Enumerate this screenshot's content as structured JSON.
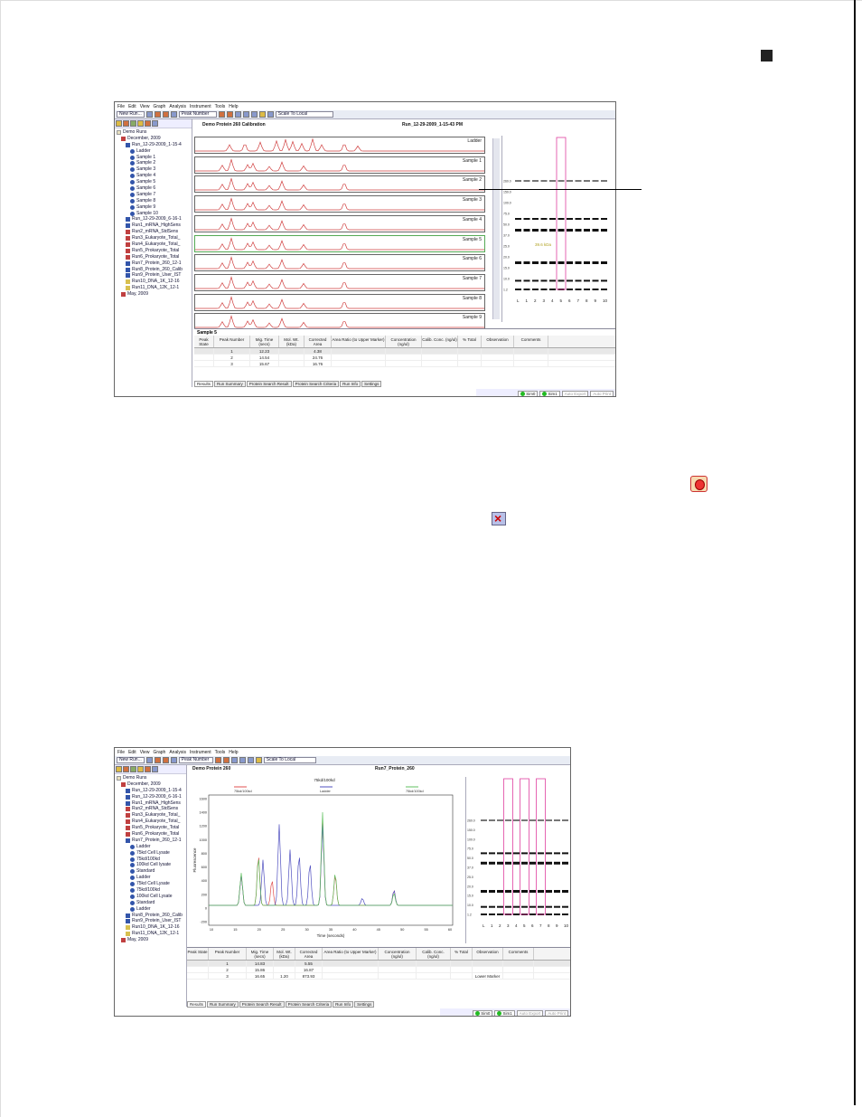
{
  "page": {
    "marker": "black-square",
    "callout": "callout-line"
  },
  "window1": {
    "menu": [
      "File",
      "Edit",
      "View",
      "Graph",
      "Analysis",
      "Instrument",
      "Tools",
      "Help"
    ],
    "toolbar": {
      "new_run": "New Run...",
      "peak_mode": "Peak Number",
      "scale_mode": "Scale To Local"
    },
    "tree": [
      {
        "label": "Demo Runs",
        "icon": "folder",
        "indent": 0
      },
      {
        "label": "December, 2009",
        "icon": "calendar",
        "indent": 1
      },
      {
        "label": "Run_12-29-2009_1-15-4",
        "icon": "run",
        "indent": 2
      },
      {
        "label": "Ladder",
        "icon": "circle",
        "indent": 3
      },
      {
        "label": "Sample 1",
        "icon": "circle",
        "indent": 3
      },
      {
        "label": "Sample 2",
        "icon": "circle",
        "indent": 3
      },
      {
        "label": "Sample 3",
        "icon": "circle",
        "indent": 3
      },
      {
        "label": "Sample 4",
        "icon": "circle",
        "indent": 3
      },
      {
        "label": "Sample 5",
        "icon": "circle",
        "indent": 3
      },
      {
        "label": "Sample 6",
        "icon": "circle",
        "indent": 3
      },
      {
        "label": "Sample 7",
        "icon": "circle",
        "indent": 3
      },
      {
        "label": "Sample 8",
        "icon": "circle",
        "indent": 3
      },
      {
        "label": "Sample 9",
        "icon": "circle",
        "indent": 3
      },
      {
        "label": "Sample 10",
        "icon": "circle",
        "indent": 3
      },
      {
        "label": "Run_12-29-2009_6-16-1",
        "icon": "run",
        "indent": 2
      },
      {
        "label": "Run1_mRNA_HighSens",
        "icon": "run",
        "indent": 2
      },
      {
        "label": "Run2_mRNA_StdSens",
        "icon": "run-red",
        "indent": 2
      },
      {
        "label": "Run3_Eukaryote_Total_",
        "icon": "run-red",
        "indent": 2
      },
      {
        "label": "Run4_Eukaryote_Total_",
        "icon": "run-red",
        "indent": 2
      },
      {
        "label": "Run5_Prokaryote_Total",
        "icon": "run-red",
        "indent": 2
      },
      {
        "label": "Run6_Prokaryote_Total",
        "icon": "run-red",
        "indent": 2
      },
      {
        "label": "Run7_Protein_260_12-1",
        "icon": "run",
        "indent": 2
      },
      {
        "label": "Run8_Protein_260_Calib",
        "icon": "run",
        "indent": 2
      },
      {
        "label": "Run9_Protein_User_IST",
        "icon": "run",
        "indent": 2
      },
      {
        "label": "Run10_DNA_1K_12-16",
        "icon": "run-yellow",
        "indent": 2
      },
      {
        "label": "Run11_DNA_12K_12-1",
        "icon": "run-yellow",
        "indent": 2
      },
      {
        "label": "May, 2009",
        "icon": "calendar",
        "indent": 1
      }
    ],
    "header_left": "Demo Protein 260 Calibration",
    "header_right": "Run_12-29-2009_1-15-43 PM",
    "traces": [
      "Ladder",
      "Sample 1",
      "Sample 2",
      "Sample 3",
      "Sample 4",
      "Sample 5",
      "Sample 6",
      "Sample 7",
      "Sample 8",
      "Sample 9"
    ],
    "gel": {
      "markers": [
        "260.0",
        "150.0",
        "100.0",
        "75.0",
        "50.0",
        "37.0",
        "25.0",
        "20.0",
        "15.0",
        "10.0",
        "1.2"
      ],
      "lanes": [
        "L",
        "1",
        "2",
        "3",
        "4",
        "5",
        "6",
        "7",
        "8",
        "9",
        "10"
      ],
      "annotation": "39.6 kDa"
    },
    "table": {
      "title": "Sample 5",
      "headers": [
        "Peak State",
        "Peak Number",
        "Mig. Time (secs)",
        "Mol. Wt. (kDa)",
        "Corrected Area",
        "Area Ratio (to Upper Marker)",
        "Concentration (ng/ul)",
        "Calib. Conc. (ng/ul)",
        "% Total",
        "Observation",
        "Comments"
      ],
      "rows": [
        [
          "",
          "1",
          "12.23",
          "",
          "4.38",
          "",
          "",
          "",
          "",
          "",
          ""
        ],
        [
          "",
          "2",
          "14.54",
          "",
          "24.76",
          "",
          "",
          "",
          "",
          "",
          ""
        ],
        [
          "",
          "3",
          "15.67",
          "",
          "16.76",
          "",
          "",
          "",
          "",
          "",
          ""
        ]
      ]
    },
    "tabs": [
      "Results",
      "Run Summary",
      "Protein Search Result",
      "Protein Search Criteria",
      "Run Info",
      "Settings"
    ],
    "status": {
      "sim0": "Sim0",
      "sim1": "Sim1",
      "auto_export": "Auto Export",
      "auto_print": "Auto Print"
    }
  },
  "window2": {
    "menu": [
      "File",
      "Edit",
      "View",
      "Graph",
      "Analysis",
      "Instrument",
      "Tools",
      "Help"
    ],
    "toolbar": {
      "new_run": "New Run...",
      "peak_mode": "Peak Number",
      "scale_mode": "Scale To Local"
    },
    "tree": [
      {
        "label": "Demo Runs",
        "icon": "folder",
        "indent": 0
      },
      {
        "label": "December, 2009",
        "icon": "calendar",
        "indent": 1
      },
      {
        "label": "Run_12-29-2009_1-15-4",
        "icon": "run",
        "indent": 2
      },
      {
        "label": "Run_12-29-2009_6-16-1",
        "icon": "run",
        "indent": 2
      },
      {
        "label": "Run1_mRNA_HighSens",
        "icon": "run",
        "indent": 2
      },
      {
        "label": "Run2_mRNA_StdSens",
        "icon": "run-red",
        "indent": 2
      },
      {
        "label": "Run3_Eukaryote_Total_",
        "icon": "run-red",
        "indent": 2
      },
      {
        "label": "Run4_Eukaryote_Total_",
        "icon": "run-red",
        "indent": 2
      },
      {
        "label": "Run5_Prokaryote_Total",
        "icon": "run-red",
        "indent": 2
      },
      {
        "label": "Run6_Prokaryote_Total",
        "icon": "run-red",
        "indent": 2
      },
      {
        "label": "Run7_Protein_260_12-1",
        "icon": "run",
        "indent": 2
      },
      {
        "label": "Ladder",
        "icon": "circle",
        "indent": 3
      },
      {
        "label": "75kd Cell Lysate",
        "icon": "circle",
        "indent": 3
      },
      {
        "label": "75kd/100kd",
        "icon": "circle",
        "indent": 3
      },
      {
        "label": "100kd Cell lysate",
        "icon": "circle",
        "indent": 3
      },
      {
        "label": "Standard",
        "icon": "circle",
        "indent": 3
      },
      {
        "label": "Ladder",
        "icon": "circle",
        "indent": 3
      },
      {
        "label": "75kd Cell Lysate",
        "icon": "circle",
        "indent": 3
      },
      {
        "label": "75kd/100kd",
        "icon": "circle",
        "indent": 3
      },
      {
        "label": "100kd Cell Lysate",
        "icon": "circle",
        "indent": 3
      },
      {
        "label": "Standard",
        "icon": "circle",
        "indent": 3
      },
      {
        "label": "Ladder",
        "icon": "circle",
        "indent": 3
      },
      {
        "label": "Run8_Protein_260_Calib",
        "icon": "run",
        "indent": 2
      },
      {
        "label": "Run9_Protein_User_IST",
        "icon": "run",
        "indent": 2
      },
      {
        "label": "Run10_DNA_1K_12-16",
        "icon": "run-yellow",
        "indent": 2
      },
      {
        "label": "Run11_DNA_12K_12-1",
        "icon": "run-yellow",
        "indent": 2
      },
      {
        "label": "May, 2009",
        "icon": "calendar",
        "indent": 1
      }
    ],
    "header_left": "Demo Protein 260",
    "header_right": "Run7_Protein_260",
    "overlay": {
      "title": "75kd/100kd",
      "legend": [
        {
          "name": "75kd/100kd",
          "color": "#e05050"
        },
        {
          "name": "Ladder",
          "color": "#5050c0"
        },
        {
          "name": "75kd/100kd",
          "color": "#60c060"
        }
      ],
      "ylabel": "Fluorescence",
      "xlabel": "Time (seconds)",
      "yticks": [
        "1600",
        "1400",
        "1200",
        "1000",
        "800",
        "600",
        "400",
        "200",
        "0",
        "-200"
      ],
      "xticks": [
        "10",
        "15",
        "20",
        "25",
        "30",
        "35",
        "40",
        "45",
        "50",
        "55",
        "60"
      ]
    },
    "gel": {
      "markers": [
        "260.0",
        "150.0",
        "100.0",
        "75.0",
        "50.0",
        "37.0",
        "25.0",
        "20.0",
        "15.0",
        "10.0",
        "1.2"
      ],
      "lanes": [
        "L",
        "1",
        "2",
        "3",
        "4",
        "5",
        "6",
        "7",
        "8",
        "9",
        "10"
      ]
    },
    "table": {
      "headers": [
        "Peak State",
        "Peak Number",
        "Mig. Time (secs)",
        "Mol. Wt. (kDa)",
        "Corrected Area",
        "Area Ratio (to Upper Marker)",
        "Concentration (ng/ul)",
        "Calib. Conc. (ng/ul)",
        "% Total",
        "Observation",
        "Comments"
      ],
      "rows": [
        [
          "",
          "1",
          "14.83",
          "",
          "5.55",
          "",
          "",
          "",
          "",
          "",
          ""
        ],
        [
          "",
          "2",
          "15.86",
          "",
          "16.87",
          "",
          "",
          "",
          "",
          "",
          ""
        ],
        [
          "",
          "3",
          "16.65",
          "1.20",
          "873.93",
          "",
          "",
          "",
          "",
          "Lower Marker",
          ""
        ]
      ]
    },
    "tabs": [
      "Results",
      "Run Summary",
      "Protein Search Result",
      "Protein Search Criteria",
      "Run Info",
      "Settings"
    ],
    "status": {
      "sim0": "Sim0",
      "sim1": "Sim1",
      "auto_export": "Auto Export",
      "auto_print": "Auto Print"
    }
  },
  "icons": {
    "peak_toggle": "peak-overlay-icon",
    "exclude": "exclude-peak-icon"
  }
}
